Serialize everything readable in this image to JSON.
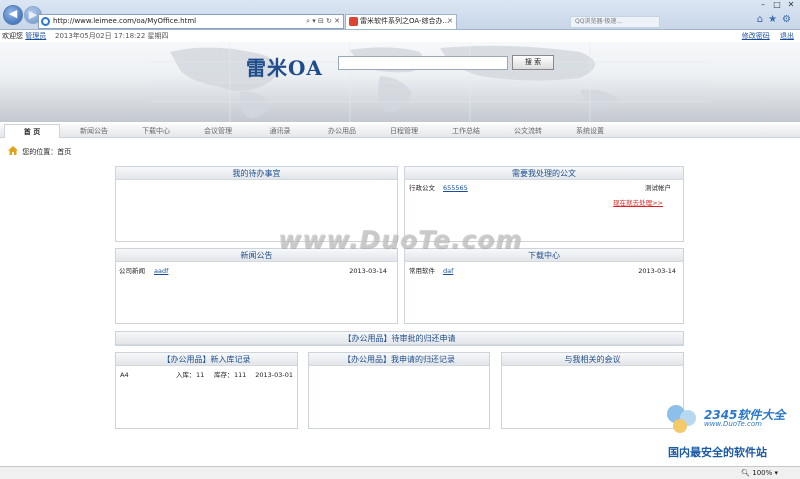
{
  "browser": {
    "url": "http://www.leimee.com/oa/MyOffice.html",
    "tab_active": "雷米软件系列之OA-综合办...",
    "tab_inactive": "",
    "tab_extra": "QQ浏览器·极速...",
    "status_zoom": "100%"
  },
  "userbar": {
    "welcome": "欢迎您",
    "username": "管理员",
    "datetime": "2013年05月02日 17:18:22 星期四",
    "change_password": "修改密码",
    "logout": "退出"
  },
  "banner": {
    "logo": "雷米OA",
    "search_value": "",
    "search_button": "搜 索"
  },
  "nav": {
    "items": [
      "首 页",
      "新闻公告",
      "下载中心",
      "会议管理",
      "通讯录",
      "办公用品",
      "日程管理",
      "工作总结",
      "公文流转",
      "系统设置"
    ]
  },
  "location": {
    "label": "您的位置：",
    "current": "首页"
  },
  "panels": {
    "todo": {
      "title": "我的待办事宜"
    },
    "docs": {
      "title": "需要我处理的公文",
      "row": {
        "category": "行政公文",
        "code": "655565",
        "owner": "测试帐户"
      },
      "action": "现在就去处理>>"
    },
    "news": {
      "title": "新闻公告",
      "row": {
        "category": "公司新闻",
        "name": "aadf",
        "date": "2013-03-14"
      }
    },
    "download": {
      "title": "下载中心",
      "row": {
        "category": "常用软件",
        "name": "daf",
        "date": "2013-03-14"
      }
    },
    "pending": {
      "title": "【办公用品】待审批的归还申请"
    },
    "stock": {
      "title": "【办公用品】新入库记录",
      "row": {
        "name": "A4",
        "in_label": "入库：",
        "in_value": "11",
        "stock_label": "库存：",
        "stock_value": "111",
        "date": "2013-03-01"
      }
    },
    "my_apply": {
      "title": "【办公用品】我申请的归还记录"
    },
    "meetings": {
      "title": "与我相关的会议"
    }
  },
  "watermark": {
    "text": "www.DuoTe.com",
    "badge_number": "2345软件大全",
    "badge_site": "www.DuoTe.com",
    "badge_slogan": "国内最安全的软件站"
  },
  "colors": {
    "accent": "#1f4e8c",
    "link": "#1a4fa0",
    "alert": "#dd2222"
  }
}
